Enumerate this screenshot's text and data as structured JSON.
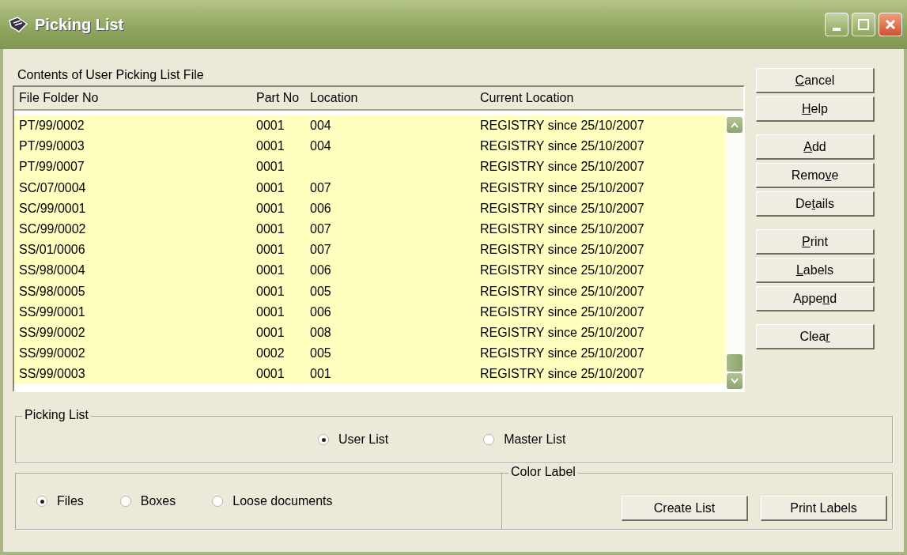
{
  "window": {
    "title": "Picking List"
  },
  "list": {
    "label": "Contents of User Picking List File",
    "columns": [
      "File Folder No",
      "Part No",
      "Location",
      "Current Location"
    ],
    "rows": [
      [
        "PT/99/0002",
        "0001",
        "004",
        "REGISTRY since 25/10/2007"
      ],
      [
        "PT/99/0003",
        "0001",
        "004",
        "REGISTRY since 25/10/2007"
      ],
      [
        "PT/99/0007",
        "0001",
        "",
        "REGISTRY since 25/10/2007"
      ],
      [
        "SC/07/0004",
        "0001",
        "007",
        "REGISTRY since 25/10/2007"
      ],
      [
        "SC/99/0001",
        "0001",
        "006",
        "REGISTRY since 25/10/2007"
      ],
      [
        "SC/99/0002",
        "0001",
        "007",
        "REGISTRY since 25/10/2007"
      ],
      [
        "SS/01/0006",
        "0001",
        "007",
        "REGISTRY since 25/10/2007"
      ],
      [
        "SS/98/0004",
        "0001",
        "006",
        "REGISTRY since 25/10/2007"
      ],
      [
        "SS/98/0005",
        "0001",
        "005",
        "REGISTRY since 25/10/2007"
      ],
      [
        "SS/99/0001",
        "0001",
        "006",
        "REGISTRY since 25/10/2007"
      ],
      [
        "SS/99/0002",
        "0001",
        "008",
        "REGISTRY since 25/10/2007"
      ],
      [
        "SS/99/0002",
        "0002",
        "005",
        "REGISTRY since 25/10/2007"
      ],
      [
        "SS/99/0003",
        "0001",
        "001",
        "REGISTRY since 25/10/2007"
      ]
    ]
  },
  "buttons": [
    {
      "parts": [
        {
          "text": "C",
          "underlined": true
        },
        {
          "text": "ancel",
          "underlined": false
        }
      ]
    },
    {
      "parts": [
        {
          "text": "H",
          "underlined": true
        },
        {
          "text": "elp",
          "underlined": false
        }
      ]
    },
    {
      "parts": [
        {
          "text": "A",
          "underlined": true
        },
        {
          "text": "dd",
          "underlined": false
        }
      ]
    },
    {
      "parts": [
        {
          "text": "Remo",
          "underlined": false
        },
        {
          "text": "v",
          "underlined": true
        },
        {
          "text": "e",
          "underlined": false
        }
      ]
    },
    {
      "parts": [
        {
          "text": "De",
          "underlined": false
        },
        {
          "text": "t",
          "underlined": true
        },
        {
          "text": "ails",
          "underlined": false
        }
      ]
    },
    {
      "parts": [
        {
          "text": "P",
          "underlined": true
        },
        {
          "text": "rint",
          "underlined": false
        }
      ]
    },
    {
      "parts": [
        {
          "text": "L",
          "underlined": true
        },
        {
          "text": "abels",
          "underlined": false
        }
      ]
    },
    {
      "parts": [
        {
          "text": "Appe",
          "underlined": false
        },
        {
          "text": "n",
          "underlined": true
        },
        {
          "text": "d",
          "underlined": false
        }
      ]
    },
    {
      "parts": [
        {
          "text": "Clea",
          "underlined": false
        },
        {
          "text": "r",
          "underlined": true
        }
      ]
    }
  ],
  "picking_list": {
    "title": "Picking List",
    "options": [
      {
        "label": "User List",
        "selected": true
      },
      {
        "label": "Master List",
        "selected": false
      }
    ]
  },
  "item_type": {
    "options": [
      {
        "label": "Files",
        "selected": true
      },
      {
        "label": "Boxes",
        "selected": false
      },
      {
        "label": "Loose documents",
        "selected": false
      }
    ]
  },
  "color_label": {
    "title": "Color Label",
    "buttons": [
      "Create List",
      "Print Labels"
    ]
  }
}
